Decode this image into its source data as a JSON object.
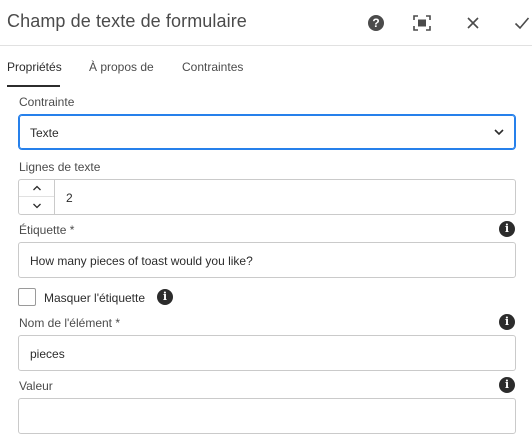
{
  "header": {
    "title": "Champ de texte de formulaire",
    "help_icon_glyph": "?",
    "buttons": [
      "help-icon",
      "fullscreen-icon",
      "close-icon",
      "check-icon"
    ]
  },
  "tabs": [
    {
      "label": "Propriétés",
      "active": true
    },
    {
      "label": "À propos de",
      "active": false
    },
    {
      "label": "Contraintes",
      "active": false
    }
  ],
  "form": {
    "constraint": {
      "label": "Contrainte",
      "value": "Texte"
    },
    "lines": {
      "label": "Lignes de texte",
      "value": "2"
    },
    "caption": {
      "label": "Étiquette *",
      "value": "How many pieces of toast would you like?"
    },
    "hide_caption": {
      "label": "Masquer l'étiquette",
      "checked": false
    },
    "element_name": {
      "label": "Nom de l'élément *",
      "value": "pieces"
    },
    "value": {
      "label": "Valeur",
      "value": ""
    }
  },
  "icons": {
    "info": "i"
  },
  "colors": {
    "accent": "#2680eb",
    "text": "#2c2c2c",
    "border": "#cacaca"
  }
}
